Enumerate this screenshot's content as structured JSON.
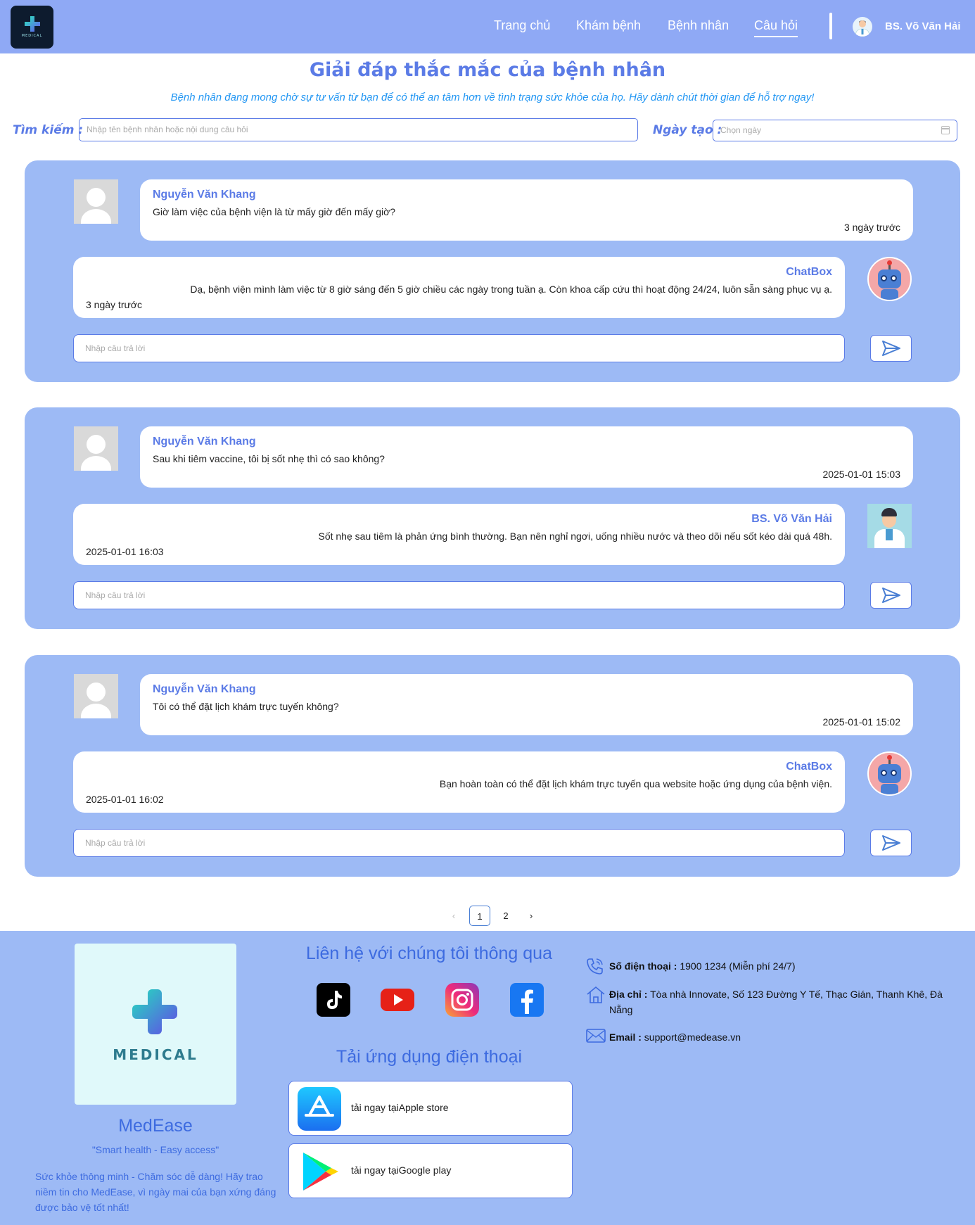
{
  "header": {
    "logo_text": "MEDICAL",
    "nav": [
      "Trang chủ",
      "Khám bệnh",
      "Bệnh nhân",
      "Câu hỏi"
    ],
    "active_nav": "Câu hỏi",
    "user_name": "BS. Võ Văn Hải"
  },
  "page": {
    "title": "Giải đáp thắc mắc của bệnh nhân",
    "subtitle": "Bệnh nhân đang mong chờ sự tư vấn từ bạn để có thể an tâm hơn về tình trạng sức khỏe của họ. Hãy dành chút thời gian để hỗ trợ ngay!"
  },
  "search": {
    "label": "Tìm kiếm :",
    "placeholder": "Nhập tên bệnh nhân hoặc nội dung câu hỏi",
    "date_label": "Ngày tạo :",
    "date_placeholder": "Chọn ngày"
  },
  "questions": [
    {
      "asker": "Nguyễn Văn Khang",
      "question": "Giờ làm việc của bệnh viện là từ mấy giờ đến mấy giờ?",
      "question_time": "3 ngày trước",
      "responder": "ChatBox",
      "responder_type": "bot",
      "answer": "Dạ, bệnh viện mình làm việc từ 8 giờ sáng đến 5 giờ chiều các ngày trong tuần ạ. Còn khoa cấp cứu thì hoạt động 24/24, luôn sẵn sàng phục vụ ạ.",
      "answer_time": "3 ngày trước",
      "reply_placeholder": "Nhập câu trả lời"
    },
    {
      "asker": "Nguyễn Văn Khang",
      "question": "Sau khi tiêm vaccine, tôi bị sốt nhẹ thì có sao không?",
      "question_time": "2025-01-01 15:03",
      "responder": "BS. Võ Văn Hải",
      "responder_type": "doctor",
      "answer": "Sốt nhẹ sau tiêm là phản ứng bình thường. Bạn nên nghỉ ngơi, uống nhiều nước và theo dõi nếu sốt kéo dài quá 48h.",
      "answer_time": "2025-01-01 16:03",
      "reply_placeholder": "Nhập câu trả lời"
    },
    {
      "asker": "Nguyễn Văn Khang",
      "question": "Tôi có thể đặt lịch khám trực tuyến không?",
      "question_time": "2025-01-01 15:02",
      "responder": "ChatBox",
      "responder_type": "bot",
      "answer": "Bạn hoàn toàn có thể đặt lịch khám trực tuyến qua website hoặc ứng dụng của bệnh viện.",
      "answer_time": "2025-01-01 16:02",
      "reply_placeholder": "Nhập câu trả lời"
    }
  ],
  "pagination": {
    "pages": [
      "1",
      "2"
    ],
    "current": "1"
  },
  "footer": {
    "logo_text": "MEDICAL",
    "brand": "MedEase",
    "slogan": "\"Smart health - Easy access\"",
    "description": "Sức khỏe thông minh - Chăm sóc dễ dàng! Hãy trao niềm tin cho MedEase, vì ngày mai của bạn xứng đáng được bảo vệ tốt nhất!",
    "contact_title": "Liên hệ với chúng tôi thông qua",
    "socials": [
      "tiktok-icon",
      "youtube-icon",
      "instagram-icon",
      "facebook-icon"
    ],
    "app_title": "Tải ứng dụng điện thoại",
    "apple_label": "tải ngay tạiApple store",
    "google_label": "tải ngay tạiGoogle play",
    "phone_label": "Số điện thoại :",
    "phone_value": "1900 1234 (Miễn phí 24/7)",
    "address_label": "Địa chỉ :",
    "address_value": "Tòa nhà Innovate, Số 123 Đường Y Tế, Thạc Gián, Thanh Khê, Đà Nẵng",
    "email_label": "Email :",
    "email_value": "support@medease.vn"
  },
  "colors": {
    "header_bg": "#8fa9f5",
    "card_bg": "#9dbaf5",
    "accent": "#5b7be6",
    "subtitle": "#2196f3"
  }
}
